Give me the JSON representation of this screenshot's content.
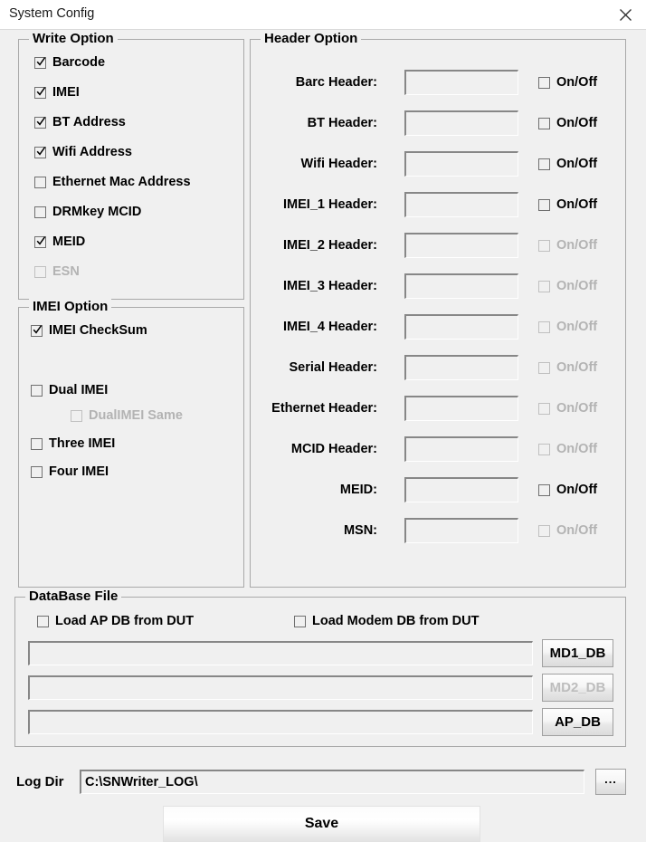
{
  "window": {
    "title": "System Config",
    "close_icon": "close-icon"
  },
  "write_option": {
    "title": "Write Option",
    "items": [
      {
        "label": "Barcode",
        "checked": true,
        "disabled": false
      },
      {
        "label": "IMEI",
        "checked": true,
        "disabled": false
      },
      {
        "label": "BT Address",
        "checked": true,
        "disabled": false
      },
      {
        "label": "Wifi Address",
        "checked": true,
        "disabled": false
      },
      {
        "label": "Ethernet Mac Address",
        "checked": false,
        "disabled": false
      },
      {
        "label": "DRMkey MCID",
        "checked": false,
        "disabled": false
      },
      {
        "label": "MEID",
        "checked": true,
        "disabled": false
      },
      {
        "label": "ESN",
        "checked": false,
        "disabled": true
      }
    ]
  },
  "imei_option": {
    "title": "IMEI Option",
    "items": [
      {
        "label": "IMEI CheckSum",
        "checked": true,
        "disabled": false
      },
      {
        "label": "Dual IMEI",
        "checked": false,
        "disabled": false
      },
      {
        "label": "DualIMEI Same",
        "checked": false,
        "disabled": true
      },
      {
        "label": "Three IMEI",
        "checked": false,
        "disabled": false
      },
      {
        "label": "Four IMEI",
        "checked": false,
        "disabled": false
      }
    ]
  },
  "header_option": {
    "title": "Header Option",
    "toggle_label": "On/Off",
    "rows": [
      {
        "label": "Barc Header:",
        "value": "",
        "checked": false,
        "disabled": false
      },
      {
        "label": "BT Header:",
        "value": "",
        "checked": false,
        "disabled": false
      },
      {
        "label": "Wifi Header:",
        "value": "",
        "checked": false,
        "disabled": false
      },
      {
        "label": "IMEI_1 Header:",
        "value": "",
        "checked": false,
        "disabled": false
      },
      {
        "label": "IMEI_2 Header:",
        "value": "",
        "checked": false,
        "disabled": true
      },
      {
        "label": "IMEI_3 Header:",
        "value": "",
        "checked": false,
        "disabled": true
      },
      {
        "label": "IMEI_4 Header:",
        "value": "",
        "checked": false,
        "disabled": true
      },
      {
        "label": "Serial Header:",
        "value": "",
        "checked": false,
        "disabled": true
      },
      {
        "label": "Ethernet Header:",
        "value": "",
        "checked": false,
        "disabled": true
      },
      {
        "label": "MCID Header:",
        "value": "",
        "checked": false,
        "disabled": true
      },
      {
        "label": "MEID:",
        "value": "",
        "checked": false,
        "disabled": false
      },
      {
        "label": "MSN:",
        "value": "",
        "checked": false,
        "disabled": true
      }
    ]
  },
  "database_file": {
    "title": "DataBase File",
    "checkboxes": [
      {
        "label": "Load AP DB from DUT",
        "checked": false,
        "disabled": false
      },
      {
        "label": "Load Modem DB from DUT",
        "checked": false,
        "disabled": false
      }
    ],
    "rows": [
      {
        "value": "",
        "button": "MD1_DB",
        "disabled": false
      },
      {
        "value": "",
        "button": "MD2_DB",
        "disabled": true
      },
      {
        "value": "",
        "button": "AP_DB",
        "disabled": false
      }
    ]
  },
  "log_dir": {
    "label": "Log Dir",
    "value": "C:\\SNWriter_LOG\\",
    "browse_label": "...",
    "browse_icon": "ellipsis-icon"
  },
  "save": {
    "label": "Save"
  },
  "colors": {
    "window_bg": "#f0f0f0",
    "titlebar_bg": "#ffffff",
    "group_border": "#a9a9a9",
    "disabled_text": "#b3b3b3",
    "text": "#000000"
  }
}
